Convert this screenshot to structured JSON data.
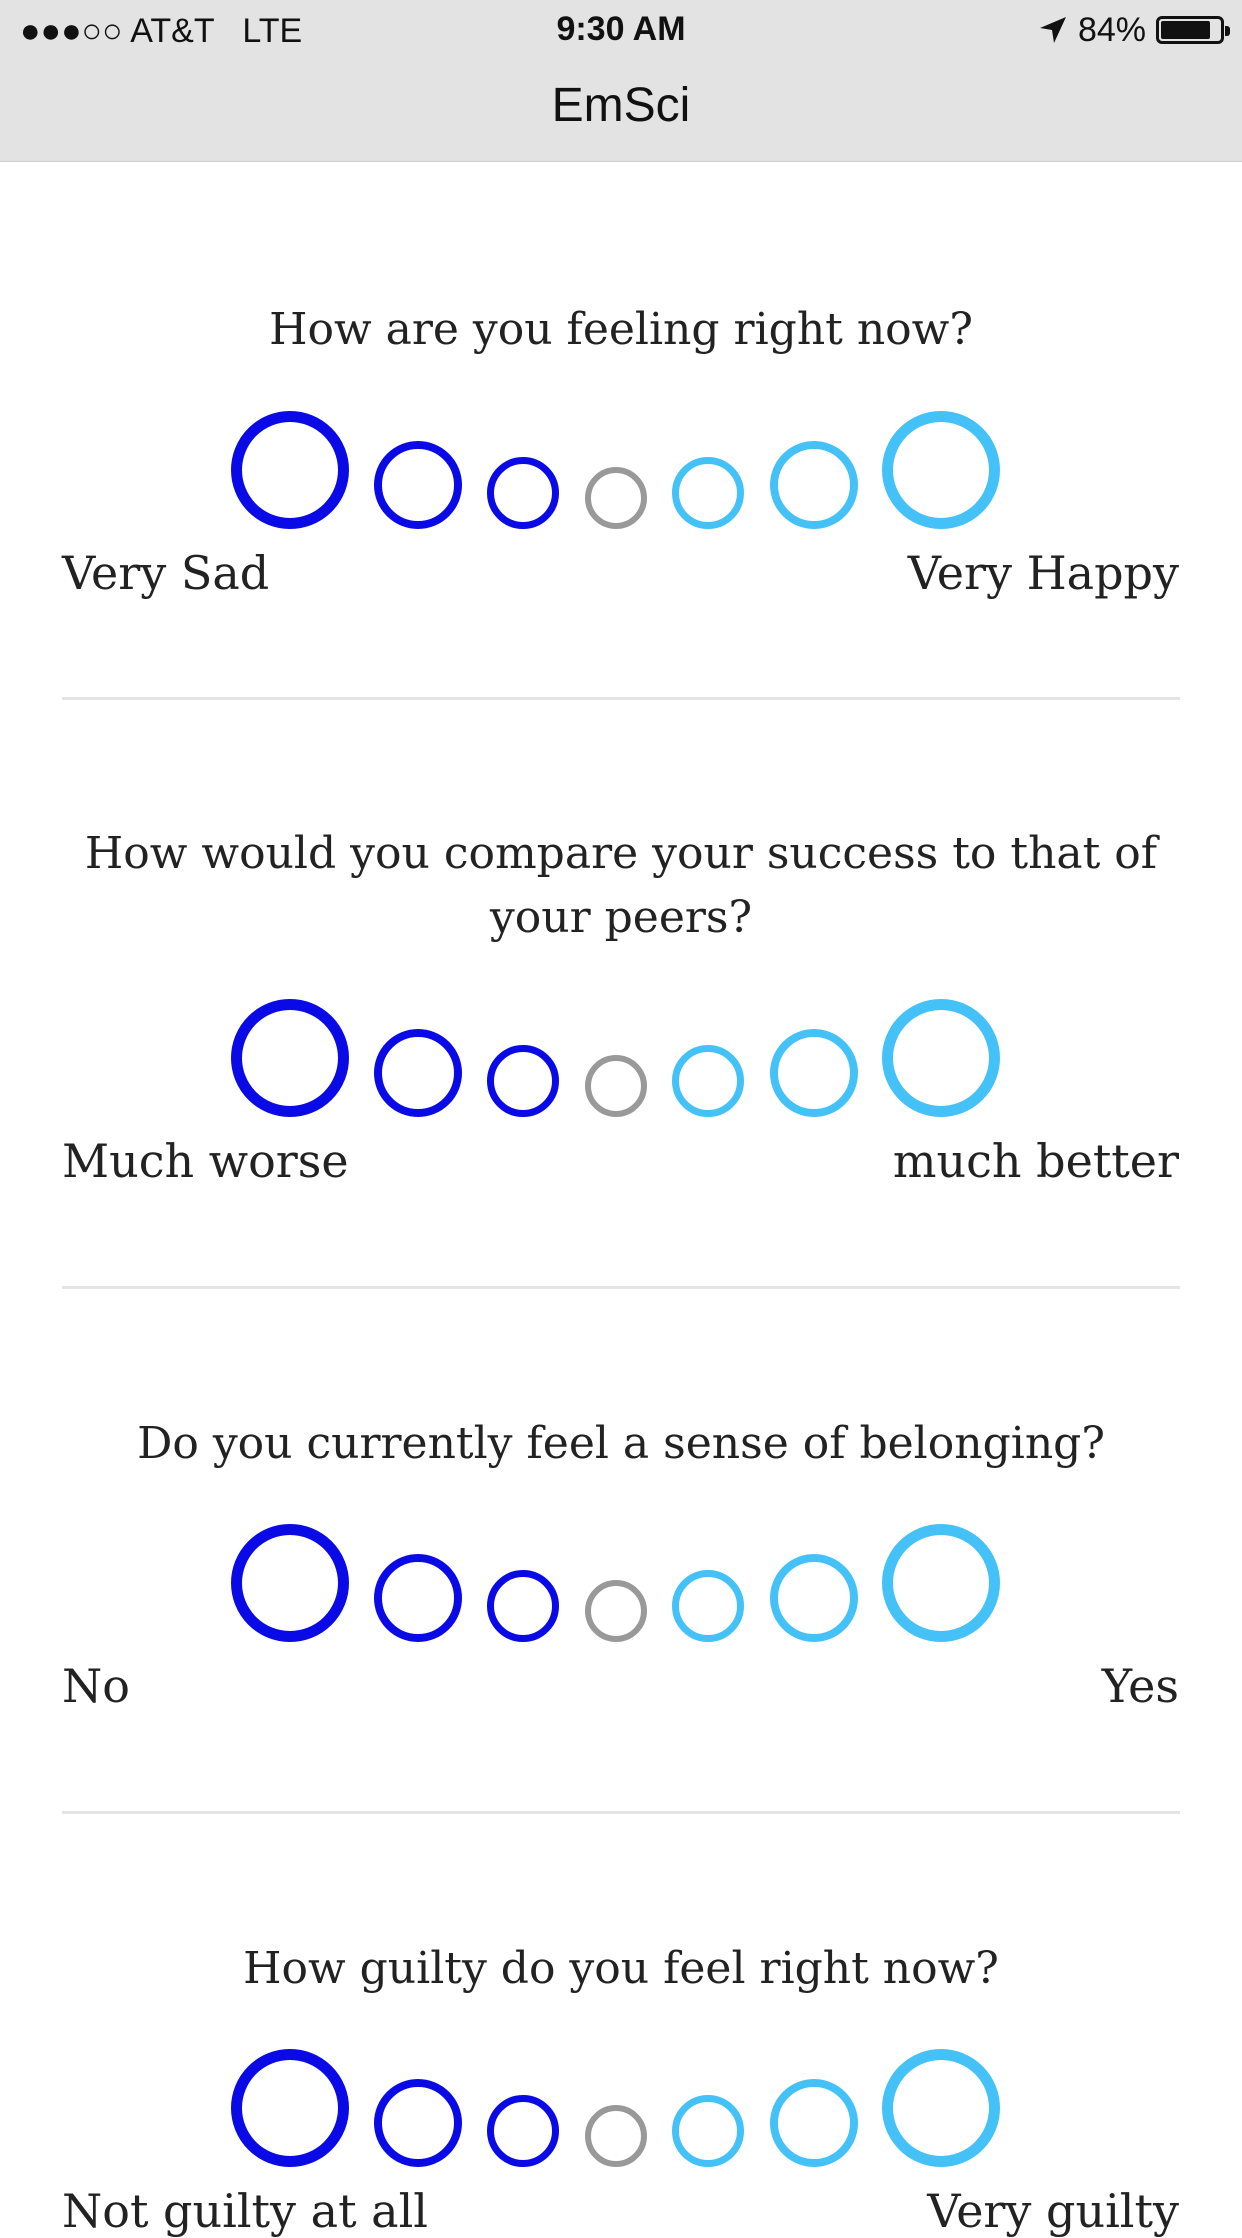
{
  "status_bar": {
    "carrier": "●●●○○ AT&T   LTE",
    "time": "9:30 AM",
    "battery": "84%",
    "location_icon": "location-arrow-icon"
  },
  "nav": {
    "title": "EmSci"
  },
  "scale_colors": [
    "#0a0ae6",
    "#0a0ae6",
    "#0a0ae6",
    "#999999",
    "#44c2f7",
    "#44c2f7",
    "#44c2f7"
  ],
  "questions": [
    {
      "text": "How are you feeling right now?",
      "left_label": "Very Sad",
      "right_label": "Very Happy"
    },
    {
      "text": "How would you compare your success to that of your peers?",
      "left_label": "Much worse",
      "right_label": "much better"
    },
    {
      "text": "Do you currently feel a sense of belonging?",
      "left_label": "No",
      "right_label": "Yes"
    },
    {
      "text": "How guilty do you feel right now?",
      "left_label": "Not guilty at all",
      "right_label": "Very guilty"
    }
  ]
}
